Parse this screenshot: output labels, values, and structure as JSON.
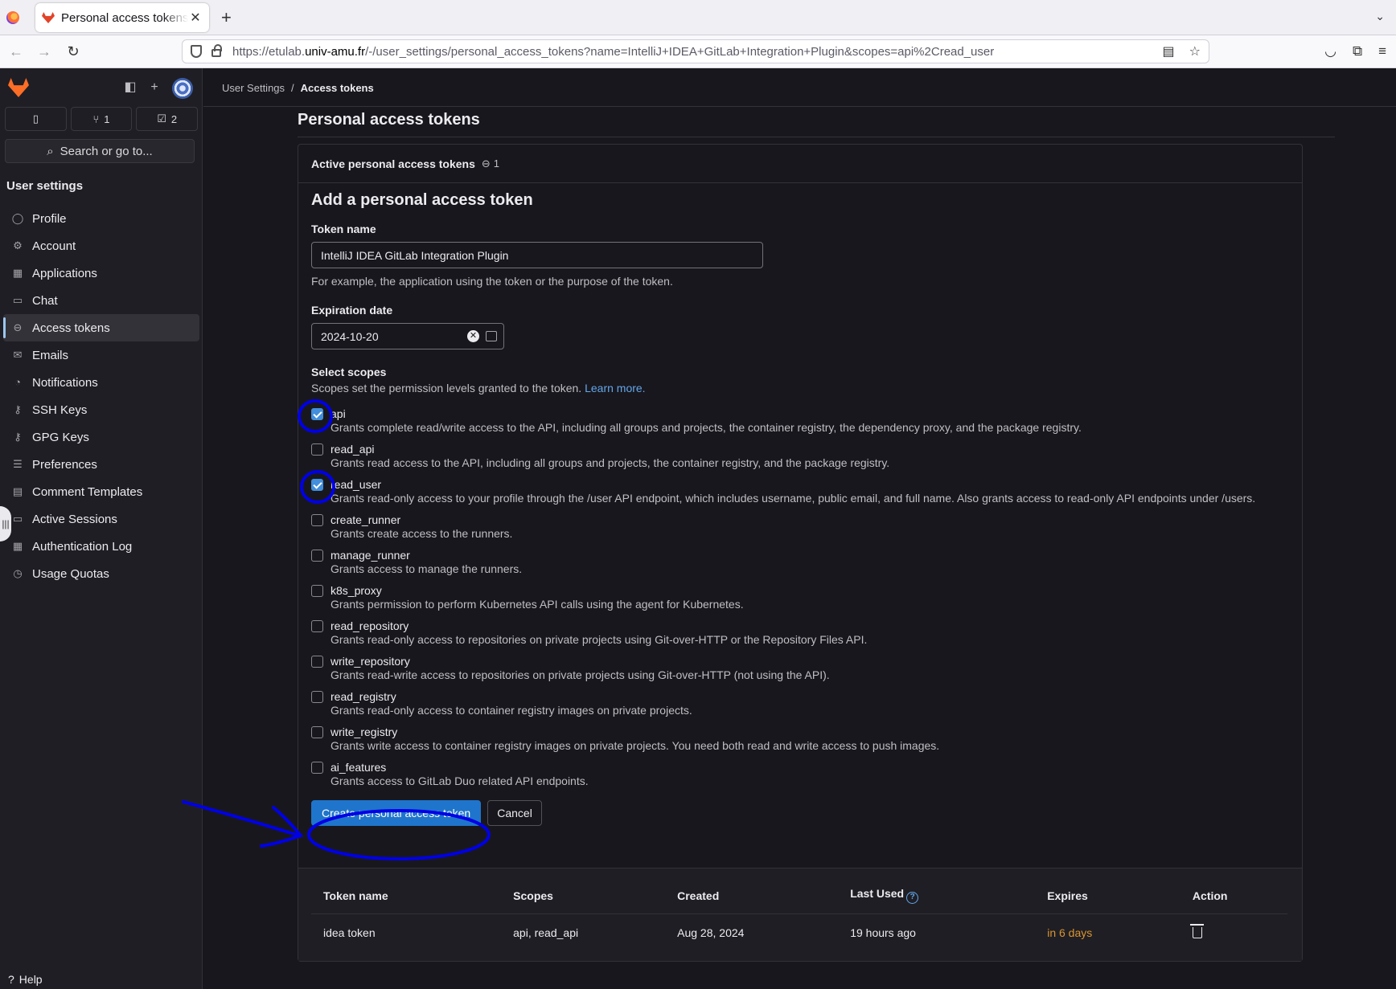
{
  "browser": {
    "tab_title": "Personal access tokens · GitLab",
    "tab_close": "✕",
    "new_tab": "+",
    "url_prefix": "https://etulab.",
    "url_host": "univ-amu.fr",
    "url_path": "/-/user_settings/personal_access_tokens?name=IntelliJ+IDEA+GitLab+Integration+Plugin&scopes=api%2Cread_user"
  },
  "sidebar": {
    "counts": [
      {
        "icon": "issues-icon",
        "value": ""
      },
      {
        "icon": "merge-request-icon",
        "value": "1"
      },
      {
        "icon": "todo-icon",
        "value": "2"
      }
    ],
    "search_label": "Search or go to...",
    "section_title": "User settings",
    "items": [
      {
        "label": "Profile",
        "icon": "profile-icon",
        "glyph": "◯"
      },
      {
        "label": "Account",
        "icon": "account-icon",
        "glyph": "⚙"
      },
      {
        "label": "Applications",
        "icon": "applications-icon",
        "glyph": "▦"
      },
      {
        "label": "Chat",
        "icon": "chat-icon",
        "glyph": "▭"
      },
      {
        "label": "Access tokens",
        "icon": "token-icon",
        "glyph": "⊖",
        "active": true
      },
      {
        "label": "Emails",
        "icon": "email-icon",
        "glyph": "✉"
      },
      {
        "label": "Notifications",
        "icon": "bell-icon",
        "glyph": "◔"
      },
      {
        "label": "SSH Keys",
        "icon": "key-icon",
        "glyph": "⚷"
      },
      {
        "label": "GPG Keys",
        "icon": "key-icon",
        "glyph": "⚷"
      },
      {
        "label": "Preferences",
        "icon": "preferences-icon",
        "glyph": "☰"
      },
      {
        "label": "Comment Templates",
        "icon": "comment-icon",
        "glyph": "▤"
      },
      {
        "label": "Active Sessions",
        "icon": "monitor-icon",
        "glyph": "▭"
      },
      {
        "label": "Authentication Log",
        "icon": "log-icon",
        "glyph": "▦"
      },
      {
        "label": "Usage Quotas",
        "icon": "quota-icon",
        "glyph": "◷"
      }
    ],
    "help_label": "Help"
  },
  "breadcrumb": {
    "parent": "User Settings",
    "separator": "/",
    "current": "Access tokens"
  },
  "page": {
    "title": "Personal access tokens",
    "active_header": "Active personal access tokens",
    "active_count": "1"
  },
  "form": {
    "heading": "Add a personal access token",
    "token_name_label": "Token name",
    "token_name_value": "IntelliJ IDEA GitLab Integration Plugin",
    "token_name_help": "For example, the application using the token or the purpose of the token.",
    "expiration_label": "Expiration date",
    "expiration_value": "2024-10-20",
    "scopes_label": "Select scopes",
    "scopes_help": "Scopes set the permission levels granted to the token.",
    "learn_more": "Learn more.",
    "scopes": [
      {
        "name": "api",
        "checked": true,
        "desc": "Grants complete read/write access to the API, including all groups and projects, the container registry, the dependency proxy, and the package registry."
      },
      {
        "name": "read_api",
        "checked": false,
        "desc": "Grants read access to the API, including all groups and projects, the container registry, and the package registry."
      },
      {
        "name": "read_user",
        "checked": true,
        "desc": "Grants read-only access to your profile through the /user API endpoint, which includes username, public email, and full name. Also grants access to read-only API endpoints under /users."
      },
      {
        "name": "create_runner",
        "checked": false,
        "desc": "Grants create access to the runners."
      },
      {
        "name": "manage_runner",
        "checked": false,
        "desc": "Grants access to manage the runners."
      },
      {
        "name": "k8s_proxy",
        "checked": false,
        "desc": "Grants permission to perform Kubernetes API calls using the agent for Kubernetes."
      },
      {
        "name": "read_repository",
        "checked": false,
        "desc": "Grants read-only access to repositories on private projects using Git-over-HTTP or the Repository Files API."
      },
      {
        "name": "write_repository",
        "checked": false,
        "desc": "Grants read-write access to repositories on private projects using Git-over-HTTP (not using the API)."
      },
      {
        "name": "read_registry",
        "checked": false,
        "desc": "Grants read-only access to container registry images on private projects."
      },
      {
        "name": "write_registry",
        "checked": false,
        "desc": "Grants write access to container registry images on private projects. You need both read and write access to push images."
      },
      {
        "name": "ai_features",
        "checked": false,
        "desc": "Grants access to GitLab Duo related API endpoints."
      }
    ],
    "create_button": "Create personal access token",
    "cancel_button": "Cancel"
  },
  "tokens_table": {
    "headers": [
      "Token name",
      "Scopes",
      "Created",
      "Last Used",
      "Expires",
      "Action"
    ],
    "help_mark": "?",
    "rows": [
      {
        "name": "idea token",
        "scopes": "api, read_api",
        "created": "Aug 28, 2024",
        "last_used": "19 hours ago",
        "expires": "in 6 days"
      }
    ]
  },
  "colors": {
    "accent": "#1f75cb",
    "link": "#63a6e9",
    "warning": "#d99530",
    "annotation": "#0000e6"
  }
}
